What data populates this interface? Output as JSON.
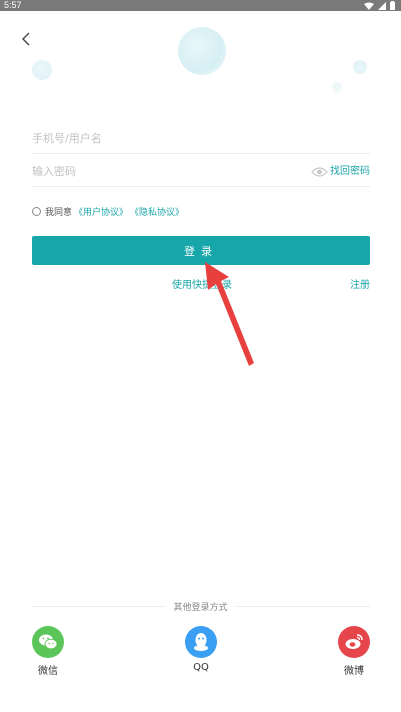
{
  "status_bar": {
    "time": "5:57"
  },
  "form": {
    "username_placeholder": "手机号/用户名",
    "password_placeholder": "输入密码",
    "find_password": "找回密码"
  },
  "agreement": {
    "prefix": "我同意",
    "user_agreement": "《用户协议》",
    "privacy_agreement": "《隐私协议》"
  },
  "actions": {
    "login_label": "登录",
    "quick_login": "使用快捷登录",
    "register": "注册"
  },
  "other_login": {
    "title": "其他登录方式",
    "providers": [
      {
        "label": "微信",
        "icon": "wechat-icon",
        "color": "#5cc55a"
      },
      {
        "label": "QQ",
        "icon": "qq-icon",
        "color": "#3a9ff2"
      },
      {
        "label": "微博",
        "icon": "weibo-icon",
        "color": "#e5454b"
      }
    ]
  },
  "colors": {
    "accent": "#17a7ab",
    "arrow": "#e8403f"
  }
}
